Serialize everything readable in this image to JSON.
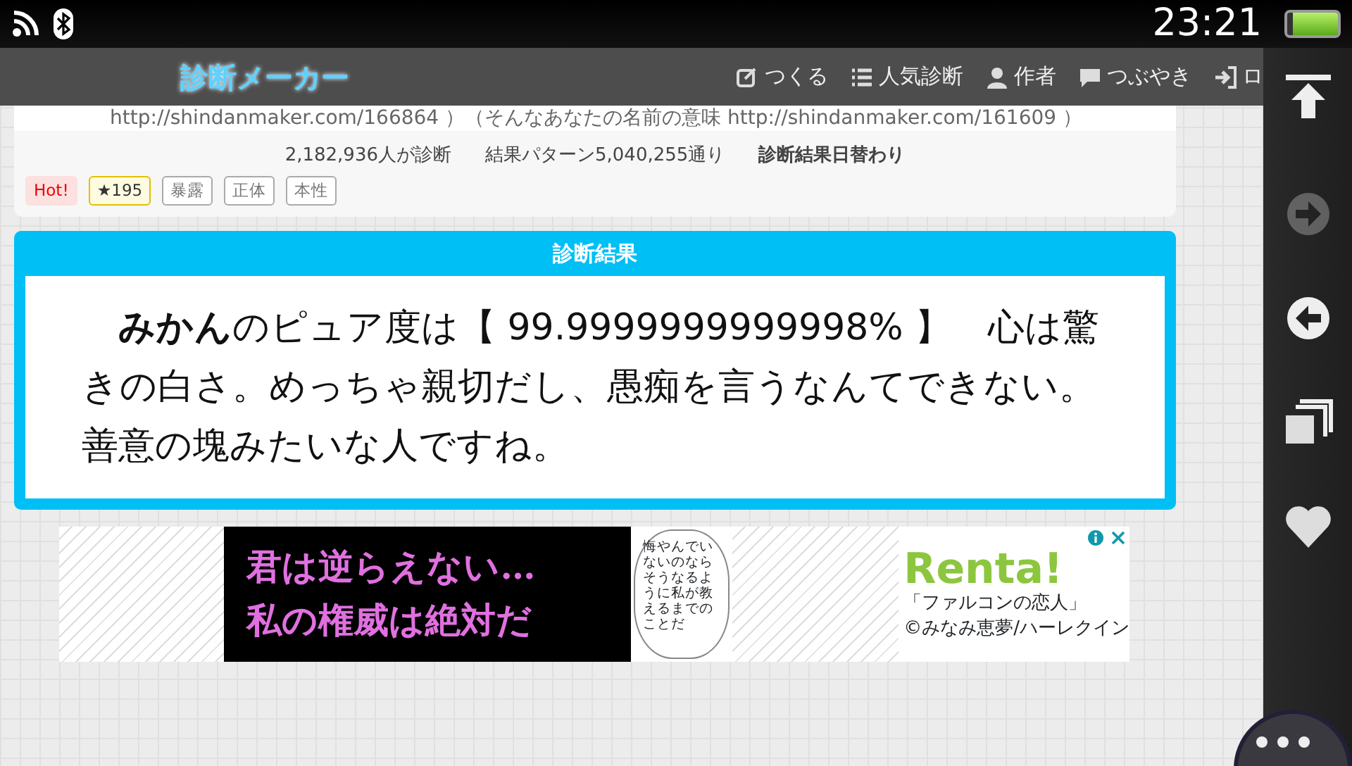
{
  "status_bar": {
    "time": "23:21"
  },
  "navbar": {
    "logo": "診断メーカー",
    "items": [
      {
        "kind": "create",
        "label": "つくる"
      },
      {
        "kind": "popular",
        "label": "人気診断"
      },
      {
        "kind": "author",
        "label": "作者"
      },
      {
        "kind": "tweet",
        "label": "つぶやき"
      },
      {
        "kind": "login",
        "label": "ロ"
      }
    ]
  },
  "info_card": {
    "links_line": "http://shindanmaker.com/166864 ）（そんなあなたの名前の意味 http://shindanmaker.com/161609 ）",
    "stats": [
      {
        "text": "2,182,936人が診断",
        "bold": false
      },
      {
        "text": "結果パターン5,040,255通り",
        "bold": false
      },
      {
        "text": "診断結果日替わり",
        "bold": true
      }
    ],
    "tags": [
      {
        "kind": "hot",
        "label": "Hot!"
      },
      {
        "kind": "star",
        "label": "★195"
      },
      {
        "kind": "tag",
        "label": "暴露"
      },
      {
        "kind": "tag",
        "label": "正体"
      },
      {
        "kind": "tag",
        "label": "本性"
      }
    ]
  },
  "result": {
    "title": "診断結果",
    "text": "　**みかん**のピュア度は【 99.9999999999998% 】　心は驚きの白さ。めっちゃ親切だし、愚痴を言うなんてできない。善意の塊みたいな人ですね。"
  },
  "ad": {
    "headline": [
      "君は逆らえない…",
      "私の権威は絶対だ"
    ],
    "bubble": "悔やんでいないのならそうなるように私が教えるまでのことだ",
    "brand": "Renta!",
    "title": "「ファルコンの恋人」",
    "credit": "©みなみ恵夢/ハーレクイン"
  },
  "side_toolbar": [
    {
      "kind": "top",
      "disabled": false
    },
    {
      "kind": "forward",
      "disabled": true
    },
    {
      "kind": "back",
      "disabled": false
    },
    {
      "kind": "tabs",
      "disabled": false
    },
    {
      "kind": "favorite",
      "disabled": false
    }
  ]
}
